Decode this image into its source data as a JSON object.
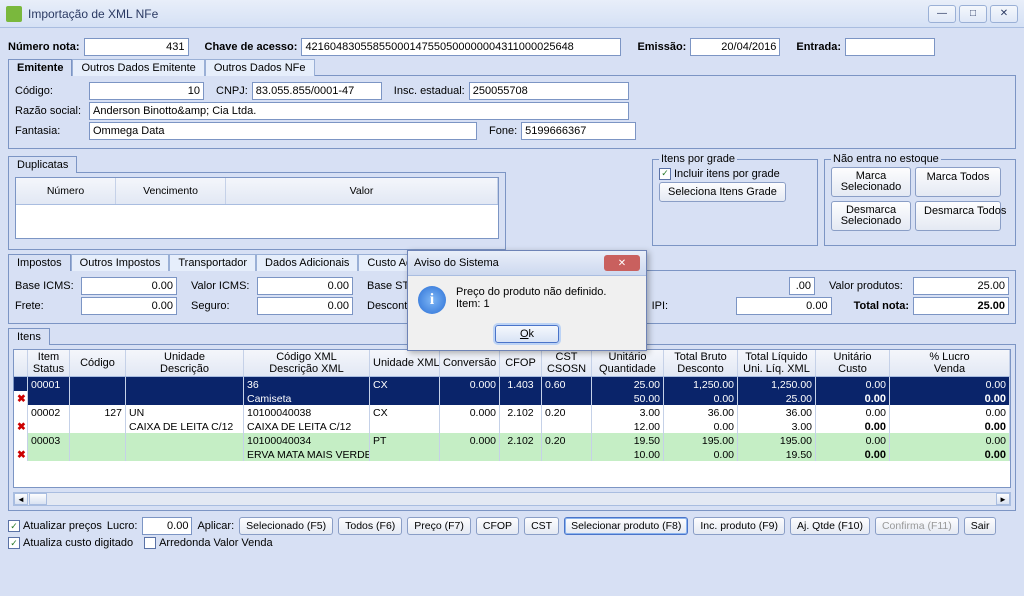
{
  "window": {
    "title": "Importação de XML NFe",
    "min": "—",
    "max": "□",
    "close": "✕"
  },
  "top": {
    "numero_nota_lbl": "Número nota:",
    "numero_nota": "431",
    "chave_lbl": "Chave de acesso:",
    "chave": "42160483055855000147550500000004311000025648",
    "emissao_lbl": "Emissão:",
    "emissao": "20/04/2016",
    "entrada_lbl": "Entrada:",
    "entrada": ""
  },
  "emit_tabs": {
    "t0": "Emitente",
    "t1": "Outros Dados Emitente",
    "t2": "Outros Dados NFe"
  },
  "emit": {
    "codigo_lbl": "Código:",
    "codigo": "10",
    "cnpj_lbl": "CNPJ:",
    "cnpj": "83.055.855/0001-47",
    "ie_lbl": "Insc. estadual:",
    "ie": "250055708",
    "razao_lbl": "Razão social:",
    "razao": "Anderson Binotto&amp; Cia Ltda.",
    "fantasia_lbl": "Fantasia:",
    "fantasia": "Ommega Data",
    "fone_lbl": "Fone:",
    "fone": "5199666367"
  },
  "dup": {
    "title": "Duplicatas",
    "h_num": "Número",
    "h_venc": "Vencimento",
    "h_valor": "Valor"
  },
  "grade": {
    "title": "Itens por grade",
    "chk": "Incluir itens por grade",
    "btn": "Seleciona Itens Grade"
  },
  "estoque": {
    "title": "Não entra no estoque",
    "marca_sel": "Marca\nSelecionado",
    "marca_todos": "Marca Todos",
    "desm_sel": "Desmarca\nSelecionado",
    "desm_todos": "Desmarca Todos"
  },
  "imp_tabs": {
    "t0": "Impostos",
    "t1": "Outros Impostos",
    "t2": "Transportador",
    "t3": "Dados Adicionais",
    "t4": "Custo Adicional"
  },
  "imp": {
    "base_icms_lbl": "Base ICMS:",
    "base_icms": "0.00",
    "valor_icms_lbl": "Valor ICMS:",
    "valor_icms": "0.00",
    "base_st_lbl": "Base ST:",
    "frete_lbl": "Frete:",
    "frete": "0.00",
    "seguro_lbl": "Seguro:",
    "seguro": "0.00",
    "desconto_lbl": "Desconto:",
    "cut": ".00",
    "valor_prod_lbl": "Valor produtos:",
    "valor_prod": "25.00",
    "ipi_lbl": "IPI:",
    "ipi": "0.00",
    "total_lbl": "Total nota:",
    "total": "25.00"
  },
  "itens": {
    "title": "Itens",
    "h": {
      "c0a": "Item",
      "c0b": "Status",
      "c1a": "Código",
      "c1b": "Descrição",
      "c2": "Unidade",
      "c3a": "Código XML",
      "c3b": "Descrição XML",
      "c4": "Unidade XML",
      "c5": "Conversão",
      "c6": "CFOP",
      "c7a": "CST",
      "c7b": "CSOSN",
      "c8a": "Unitário",
      "c8b": "Quantidade",
      "c9a": "Total Bruto",
      "c9b": "Desconto",
      "c10a": "Total Líquido",
      "c10b": "Uni. Líq. XML",
      "c11a": "Unitário",
      "c11b": "Custo",
      "c12a": "% Lucro",
      "c12b": "Venda"
    },
    "rows": [
      {
        "item": "00001",
        "cod": "",
        "un": "",
        "codxml": "36",
        "desc": "Camiseta",
        "unxml": "CX",
        "conv": "0.000",
        "cfop": "1.403",
        "cst": "0.60",
        "unit": "25.00",
        "qtd": "50.00",
        "bruto": "1,250.00",
        "desc2": "0.00",
        "liq": "1,250.00",
        "liq2": "25.00",
        "custo": "0.00",
        "custo2": "0.00",
        "venda": "0.00",
        "venda2": "0.00"
      },
      {
        "item": "00002",
        "cod": "127",
        "un": "UN",
        "codxml": "10100040038",
        "desc_top": "CAIXA DE LEITA C/12",
        "desc": "CAIXA DE LEITA C/12",
        "unxml": "CX",
        "conv": "0.000",
        "cfop": "2.102",
        "cst": "0.20",
        "unit": "3.00",
        "qtd": "12.00",
        "bruto": "36.00",
        "desc2": "0.00",
        "liq": "36.00",
        "liq2": "3.00",
        "custo": "0.00",
        "custo2": "0.00",
        "venda": "0.00",
        "venda2": "0.00"
      },
      {
        "item": "00003",
        "cod": "",
        "un": "",
        "codxml": "10100040034",
        "desc": "ERVA MATA MAIS VERDE",
        "unxml": "PT",
        "conv": "0.000",
        "cfop": "2.102",
        "cst": "0.20",
        "unit": "19.50",
        "qtd": "10.00",
        "bruto": "195.00",
        "desc2": "0.00",
        "liq": "195.00",
        "liq2": "19.50",
        "custo": "0.00",
        "custo2": "0.00",
        "venda": "0.00",
        "venda2": "0.00"
      }
    ]
  },
  "footer": {
    "atual_precos": "Atualizar preços",
    "atual_custo": "Atualiza custo digitado",
    "arred": "Arredonda Valor Venda",
    "lucro_lbl": "Lucro:",
    "lucro": "0.00",
    "aplicar": "Aplicar:",
    "b_sel": "Selecionado (F5)",
    "b_todos": "Todos (F6)",
    "b_preco": "Preço (F7)",
    "b_cfop": "CFOP",
    "b_cst": "CST",
    "b_selprod": "Selecionar produto (F8)",
    "b_inc": "Inc. produto (F9)",
    "b_ajqtde": "Aj. Qtde (F10)",
    "b_conf": "Confirma (F11)",
    "b_sair": "Sair"
  },
  "dialog": {
    "title": "Aviso do Sistema",
    "msg1": "Preço do produto não definido.",
    "msg2": "Item: 1",
    "ok": "Ok"
  }
}
